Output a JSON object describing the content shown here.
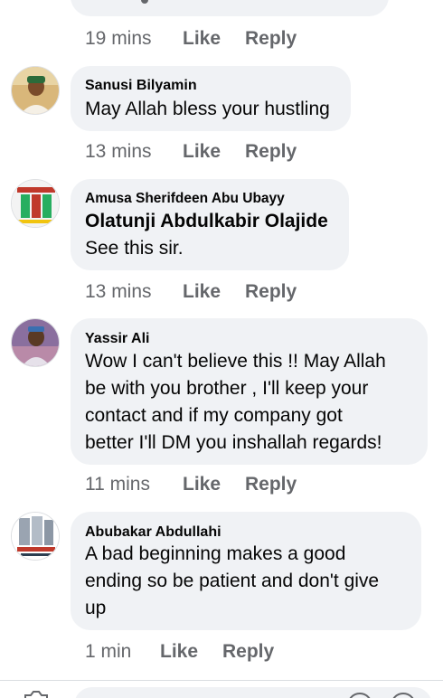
{
  "top_comment": {
    "time": "19 mins",
    "like": "Like",
    "reply": "Reply"
  },
  "comments": [
    {
      "author": "Sanusi Bilyamin",
      "text": "May Allah bless your hustling",
      "time": "13 mins",
      "like": "Like",
      "reply": "Reply"
    },
    {
      "author": "Amusa Sherifdeen Abu Ubayy",
      "tagged": "Olatunji Abdulkabir Olajide",
      "text": "See this sir.",
      "time": "13 mins",
      "like": "Like",
      "reply": "Reply"
    },
    {
      "author": "Yassir Ali",
      "text_lines": [
        "Wow I can't believe this !! May Allah",
        "be with you brother , I'll keep your",
        "contact and if my company got",
        "better I'll DM you inshallah regards!"
      ],
      "time": "11 mins",
      "like": "Like",
      "reply": "Reply"
    },
    {
      "author": "Abubakar Abdullahi",
      "text_lines": [
        "A bad beginning makes a good",
        "ending so be patient and don't give",
        "up"
      ],
      "time": "1 min",
      "like": "Like",
      "reply": "Reply"
    }
  ],
  "colors": {
    "bubble": "#f0f2f5",
    "meta_text": "#65676b",
    "text": "#050505"
  }
}
